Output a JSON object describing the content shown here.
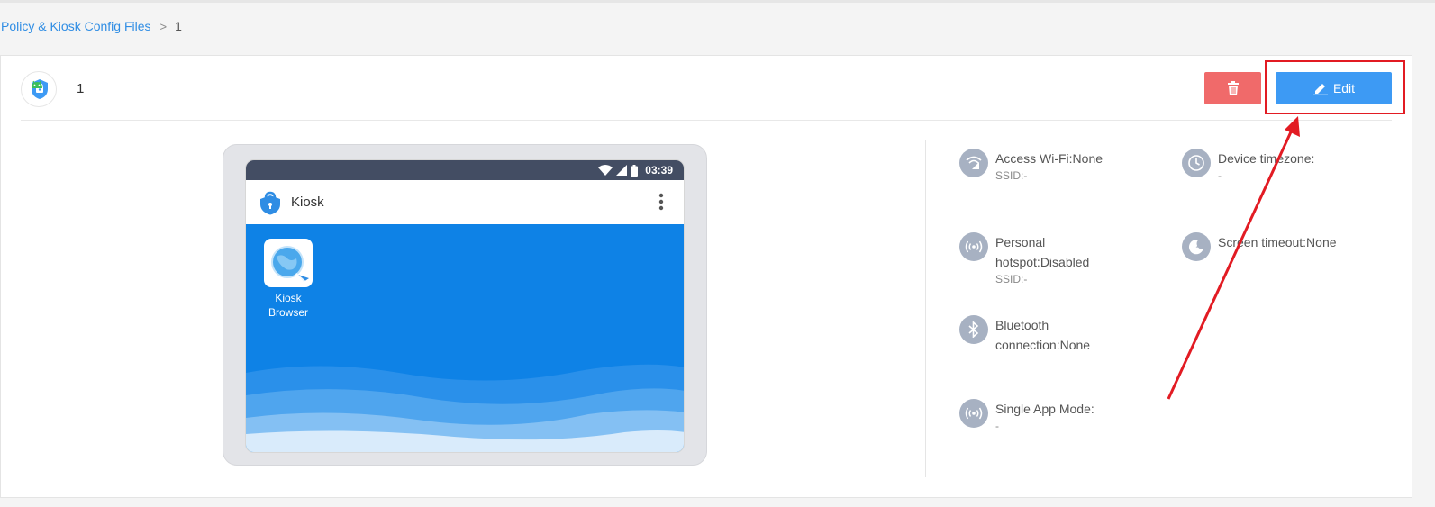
{
  "breadcrumb": {
    "root": "Policy & Kiosk Config Files",
    "separator": ">",
    "current": "1"
  },
  "policy": {
    "name": "1",
    "platform_icon": "android-icon"
  },
  "actions": {
    "delete_icon": "trash-icon",
    "edit_label": "Edit"
  },
  "device_preview": {
    "status_time": "03:39",
    "app_title": "Kiosk",
    "apps": [
      {
        "label_line1": "Kiosk",
        "label_line2": "Browser"
      }
    ]
  },
  "settings": {
    "wifi": {
      "label": "Access Wi-Fi:None",
      "sub": "SSID:-"
    },
    "timezone": {
      "label": "Device timezone:",
      "sub": "-"
    },
    "hotspot": {
      "label_line1": "Personal",
      "label_line2": "hotspot:Disabled",
      "sub": "SSID:-"
    },
    "screen_timeout": {
      "label": "Screen timeout:None"
    },
    "bluetooth": {
      "label_line1": "Bluetooth",
      "label_line2": "connection:None"
    },
    "single_app": {
      "label": "Single App Mode:",
      "sub": "-"
    }
  },
  "colors": {
    "link": "#2f8de4",
    "delete": "#f06a6a",
    "edit": "#3d9af4",
    "annotation": "#e21b23",
    "status_bar": "#434d63",
    "home_screen": "#0e82e6"
  }
}
